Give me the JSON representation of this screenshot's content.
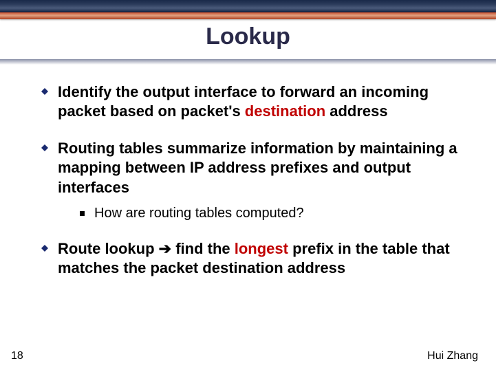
{
  "slide": {
    "title": "Lookup",
    "page_number": "18",
    "author": "Hui Zhang"
  },
  "bullets": {
    "b1_pre": "Identify the output interface to forward an incoming packet based on packet's ",
    "b1_hl": "destination",
    "b1_post": " address",
    "b2": "Routing tables summarize information by maintaining a mapping between IP address prefixes and output interfaces",
    "b2_sub": "How are routing tables computed?",
    "b3_pre": "Route lookup ",
    "b3_arrow": "➔",
    "b3_mid": " find the ",
    "b3_hl": "longest",
    "b3_post": " prefix in the table that matches the packet destination address"
  }
}
